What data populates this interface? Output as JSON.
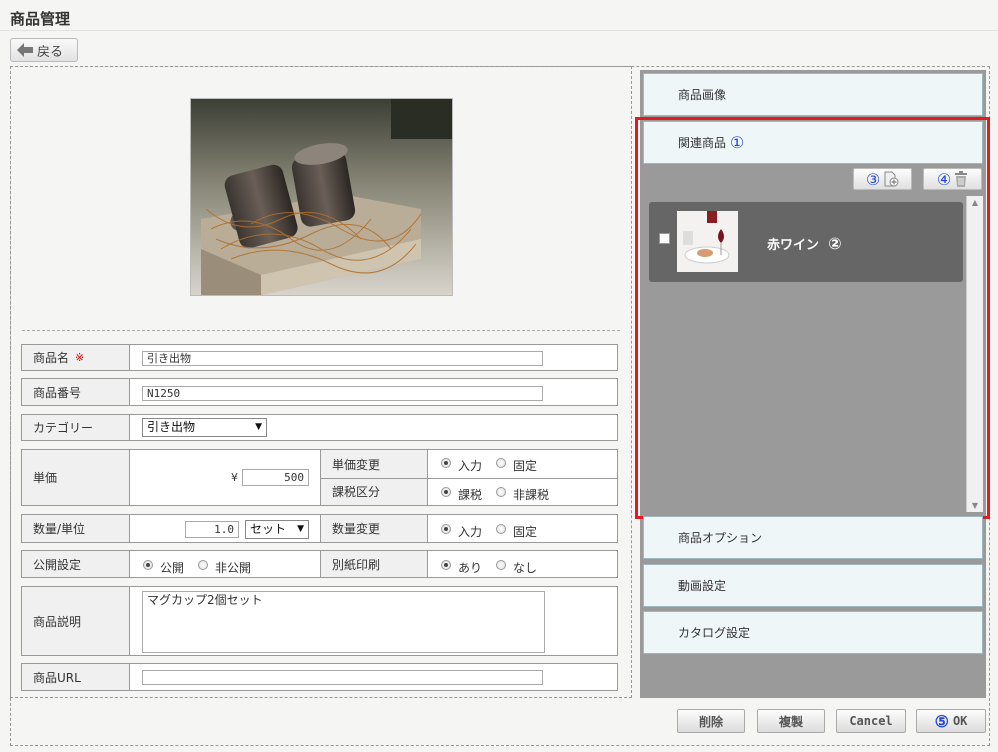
{
  "header": {
    "title": "商品管理",
    "back_label": "戻る"
  },
  "form": {
    "name_label": "商品名",
    "required_mark": "※",
    "name_value": "引き出物",
    "number_label": "商品番号",
    "number_value": "N1250",
    "category_label": "カテゴリー",
    "category_value": "引き出物",
    "price_label": "単価",
    "currency": "¥",
    "price_value": "500",
    "price_change_label": "単価変更",
    "price_change_opt1": "入力",
    "price_change_opt2": "固定",
    "tax_label": "課税区分",
    "tax_opt1": "課税",
    "tax_opt2": "非課税",
    "qty_label": "数量/単位",
    "qty_value": "1.0",
    "unit_value": "セット",
    "qty_change_label": "数量変更",
    "qty_change_opt1": "入力",
    "qty_change_opt2": "固定",
    "publish_label": "公開設定",
    "publish_opt1": "公開",
    "publish_opt2": "非公開",
    "print_label": "別紙印刷",
    "print_opt1": "あり",
    "print_opt2": "なし",
    "desc_label": "商品説明",
    "desc_value": "マグカップ2個セット",
    "url_label": "商品URL",
    "url_value": ""
  },
  "panel": {
    "sections": {
      "images": "商品画像",
      "related": "関連商品",
      "options": "商品オプション",
      "video": "動画設定",
      "catalog": "カタログ設定"
    },
    "markers": {
      "m1": "①",
      "m2": "②",
      "m3": "③",
      "m4": "④",
      "m5": "⑤"
    },
    "related_items": [
      {
        "name": "赤ワイン"
      }
    ]
  },
  "footer": {
    "delete": "削除",
    "duplicate": "複製",
    "cancel": "Cancel",
    "ok": "OK"
  },
  "colors": {
    "highlight": "#e21b23",
    "marker_blue": "#2447d8",
    "panel_gray": "#9a9a9a",
    "accordion_bg": "#eef6f8"
  },
  "icons": {
    "back": "arrow-left-icon",
    "add": "add-page-icon",
    "delete": "trash-icon"
  }
}
